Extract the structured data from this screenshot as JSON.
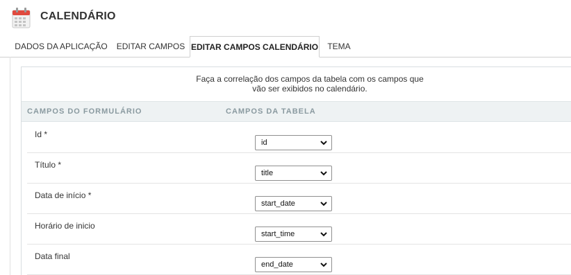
{
  "app": {
    "title": "CALENDÁRIO",
    "icon": "calendar-icon",
    "icon_color": "#e04a3f"
  },
  "tabs": [
    {
      "label": "DADOS DA APLICAÇÃO",
      "active": false
    },
    {
      "label": "EDITAR CAMPOS",
      "active": false
    },
    {
      "label": "EDITAR CAMPOS CALENDÁRIO",
      "active": true
    },
    {
      "label": "TEMA",
      "active": false
    }
  ],
  "intro": {
    "line1": "Faça a correlação dos campos da tabela com os campos que",
    "line2": "vão ser exibidos no calendário."
  },
  "columns": {
    "form_fields": "CAMPOS DO FORMULÁRIO",
    "table_fields": "CAMPOS DA TABELA"
  },
  "rows": [
    {
      "label": "Id *",
      "value": "id"
    },
    {
      "label": "Título *",
      "value": "title"
    },
    {
      "label": "Data de início *",
      "value": "start_date"
    },
    {
      "label": "Horário de inicio",
      "value": "start_time"
    },
    {
      "label": "Data final",
      "value": "end_date"
    }
  ]
}
